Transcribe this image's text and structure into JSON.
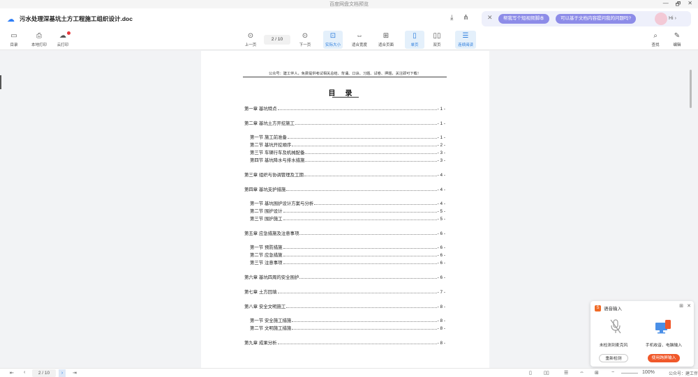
{
  "window": {
    "title": "百度网盘文档预览",
    "controls": [
      "—",
      "🗗",
      "✕"
    ]
  },
  "header": {
    "doc_title": "污水处理深基坑土方工程施工组织设计.doc",
    "ai_chips": [
      "帮我写个短视频脚本",
      "可以基于文档内容提问我的问题吗?"
    ],
    "ai_greeting": "Hi"
  },
  "toolbar": {
    "left": [
      {
        "label": "目录",
        "icon": "▭"
      },
      {
        "label": "本地打印",
        "icon": "⎙"
      },
      {
        "label": "云打印",
        "icon": "☁"
      }
    ],
    "prev_label": "上一页",
    "next_label": "下一页",
    "page_indicator": "2 / 10",
    "views": [
      {
        "label": "实际大小",
        "icon": "⊡",
        "active": true
      },
      {
        "label": "适合宽度",
        "icon": "⇔",
        "active": false
      },
      {
        "label": "适合页面",
        "icon": "⊞",
        "active": false
      },
      {
        "label": "单页",
        "icon": "▯",
        "active": true
      },
      {
        "label": "双页",
        "icon": "▯▯",
        "active": false
      },
      {
        "label": "连续阅读",
        "icon": "☰",
        "active": true
      }
    ],
    "right": [
      {
        "label": "查找",
        "icon": "⌕"
      },
      {
        "label": "编辑",
        "icon": "✎"
      }
    ]
  },
  "document": {
    "notice": "公众号：建工伴人，免费提供考试相关总结、背诵、口诀、习题、试卷、押题，关注即可下载！",
    "toc_title": "目录",
    "toc": [
      {
        "text": "第一章 基坑特点",
        "page": "- 1 -",
        "level": 1
      },
      {
        "text": "第二章 基坑土方开挖施工",
        "page": "- 1 -",
        "level": 1
      },
      {
        "text": "第一节 施工前准备",
        "page": "- 1 -",
        "level": 2
      },
      {
        "text": "第二节 基坑开挖顺序",
        "page": "- 2 -",
        "level": 2
      },
      {
        "text": "第三节 车辆行车及机械配备",
        "page": "- 3 -",
        "level": 2
      },
      {
        "text": "第四节 基坑降水与排水措施",
        "page": "- 3 -",
        "level": 2
      },
      {
        "text": "第三章 组织与协调管理及工期",
        "page": "- 4 -",
        "level": 1
      },
      {
        "text": "第四章 基坑支护措施",
        "page": "- 4 -",
        "level": 1
      },
      {
        "text": "第一节 基坑围护设计方案与分析",
        "page": "- 4 -",
        "level": 2
      },
      {
        "text": "第二节 围护设计",
        "page": "- 5 -",
        "level": 2
      },
      {
        "text": "第三节 围护施工",
        "page": "- 5 -",
        "level": 2
      },
      {
        "text": "第五章 应急措施及注意事项",
        "page": "- 6 -",
        "level": 1
      },
      {
        "text": "第一节 预防措施",
        "page": "- 6 -",
        "level": 2
      },
      {
        "text": "第二节 应急措施",
        "page": "- 6 -",
        "level": 2
      },
      {
        "text": "第三节 注意事项",
        "page": "- 6 -",
        "level": 2
      },
      {
        "text": "第六章 基坑四周的安全围护",
        "page": "- 6 -",
        "level": 1
      },
      {
        "text": "第七章 土方回填",
        "page": "- 7 -",
        "level": 1
      },
      {
        "text": "第八章 安全文明施工",
        "page": "- 8 -",
        "level": 1
      },
      {
        "text": "第一节 安全施工措施",
        "page": "- 8 -",
        "level": 2
      },
      {
        "text": "第二节 文明施工措施",
        "page": "- 8 -",
        "level": 2
      },
      {
        "text": "第九章 成果分析",
        "page": "- 8 -",
        "level": 1
      }
    ]
  },
  "statusbar": {
    "page_indicator": "2 / 10",
    "zoom": "100%"
  },
  "voice_panel": {
    "title": "语音输入",
    "no_mic": "未检测到麦克风",
    "phone_input": "手机收音、电脑输入",
    "recheck": "重新检测",
    "use_phone": "使用跨屏输入"
  },
  "watermark": "公众号：建工伴人"
}
